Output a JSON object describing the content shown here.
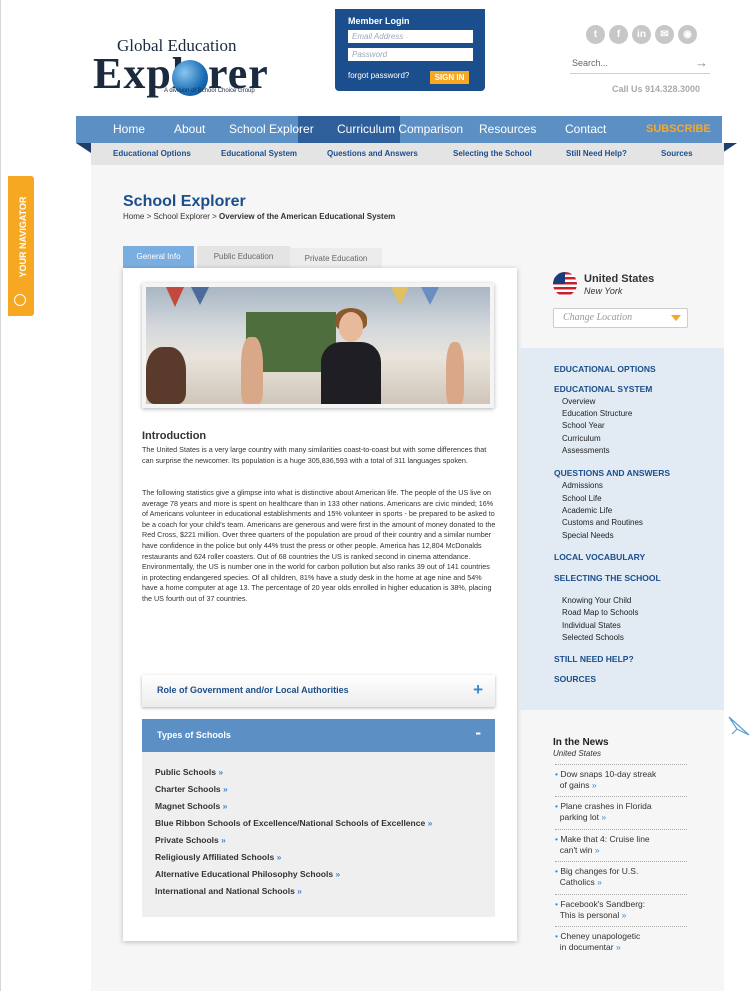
{
  "brand": {
    "logo_top": "Global Education",
    "logo_main": "Explorer",
    "logo_tag": "A division of School Choice Group"
  },
  "login": {
    "title": "Member Login",
    "email_placeholder": "Email Address",
    "password_placeholder": "Password",
    "forgot": "forgot password?",
    "signin": "SIGN IN"
  },
  "social_icons": [
    "twitter-icon",
    "facebook-icon",
    "linkedin-icon",
    "email-icon",
    "rss-icon"
  ],
  "search": {
    "placeholder": "Search...",
    "arrow": "→"
  },
  "call_us": "Call Us 914.328.3000",
  "nav": {
    "items": [
      "Home",
      "About",
      "School Explorer",
      "Curriculum Comparison",
      "Resources",
      "Contact",
      "SUBSCRIBE"
    ],
    "active": "School Explorer"
  },
  "subnav": [
    "Educational Options",
    "Educational System",
    "Questions and Answers",
    "Selecting the School",
    "Still Need Help?",
    "Sources"
  ],
  "navigator_label": "YOUR NAVIGATOR",
  "page": {
    "title": "School Explorer",
    "breadcrumb_prefix": "Home > School Explorer > ",
    "breadcrumb_current": "Overview of the American Educational System"
  },
  "tabs": [
    "General Info",
    "Public Education",
    "Private Education"
  ],
  "intro": {
    "heading": "Introduction",
    "p1": "The United States is a very large country with many similarities coast-to-coast but with some differences that can surprise the newcomer. Its population is a huge 305,836,593 with a total of 311 languages spoken.",
    "p2": "The following statistics give a glimpse into what is distinctive about American life. The people of the US live on average 78 years and more is spent on healthcare than in 133 other nations. Americans are civic minded; 16% of Americans volunteer in educational establishments and 15% volunteer in sports - be prepared to be asked to be a coach for your child's team. Americans are generous and were first in the amount of money donated to the Red Cross, $221 million. Over three quarters of the population are proud of their country and a similar number have confidence in the police but only 44% trust the press or other people. America has 12,804 McDonalds restaurants and 624 roller coasters. Out of 68 countries the US is ranked second in cinema attendance. Environmentally, the US is number one in the world for carbon pollution but also ranks 39 out of 141 countries in protecting endangered species. Of all children, 81% have a study desk in the home at age nine and 54% have a home computer at age 13. The percentage of 20 year olds enrolled in higher education is 38%, placing the US fourth out of 37 countries."
  },
  "accordion": {
    "section1": {
      "title": "Role of Government and/or Local Authorities",
      "toggle": "+"
    },
    "section2": {
      "title": "Types of Schools",
      "toggle": "-"
    },
    "schools": [
      "Public Schools",
      "Charter Schools",
      "Magnet Schools",
      "Blue Ribbon Schools of Excellence/National Schools of Excellence",
      "Private Schools",
      "Religiously Affiliated Schools",
      "Alternative Educational Philosophy Schools",
      "International and National Schools"
    ],
    "more": "»"
  },
  "location": {
    "country": "United States",
    "state": "New York",
    "change_label": "Change Location"
  },
  "sidenav": {
    "educational_options": "EDUCATIONAL OPTIONS",
    "educational_system": "EDUCATIONAL SYSTEM",
    "system_items": [
      "Overview",
      "Education Structure",
      "School Year",
      "Curriculum",
      "Assessments"
    ],
    "questions": "QUESTIONS AND ANSWERS",
    "question_items": [
      "Admissions",
      "School Life",
      "Academic Life",
      "Customs and Routines",
      "Special Needs"
    ],
    "vocabulary": "LOCAL VOCABULARY",
    "selecting": "SELECTING THE SCHOOL",
    "selecting_items": [
      "Knowing Your Child",
      "Road Map to Schools",
      "Individual States",
      "Selected Schools"
    ],
    "help": "STILL NEED HELP?",
    "sources": "SOURCES"
  },
  "news": {
    "heading": "In the News",
    "subheading": "United States",
    "items": [
      [
        "Dow snaps 10-day streak",
        "of gains"
      ],
      [
        "Plane crashes in Florida",
        "parking lot"
      ],
      [
        "Make that 4: Cruise line",
        "can't win"
      ],
      [
        "Big changes for U.S.",
        "Catholics"
      ],
      [
        "Facebook's Sandberg:",
        "This is personal"
      ],
      [
        "Cheney unapologetic",
        "in documentar"
      ]
    ]
  },
  "colors": {
    "brand_blue": "#1a4e8c",
    "nav_blue": "#5c90c5",
    "accent_orange": "#f7a823"
  }
}
